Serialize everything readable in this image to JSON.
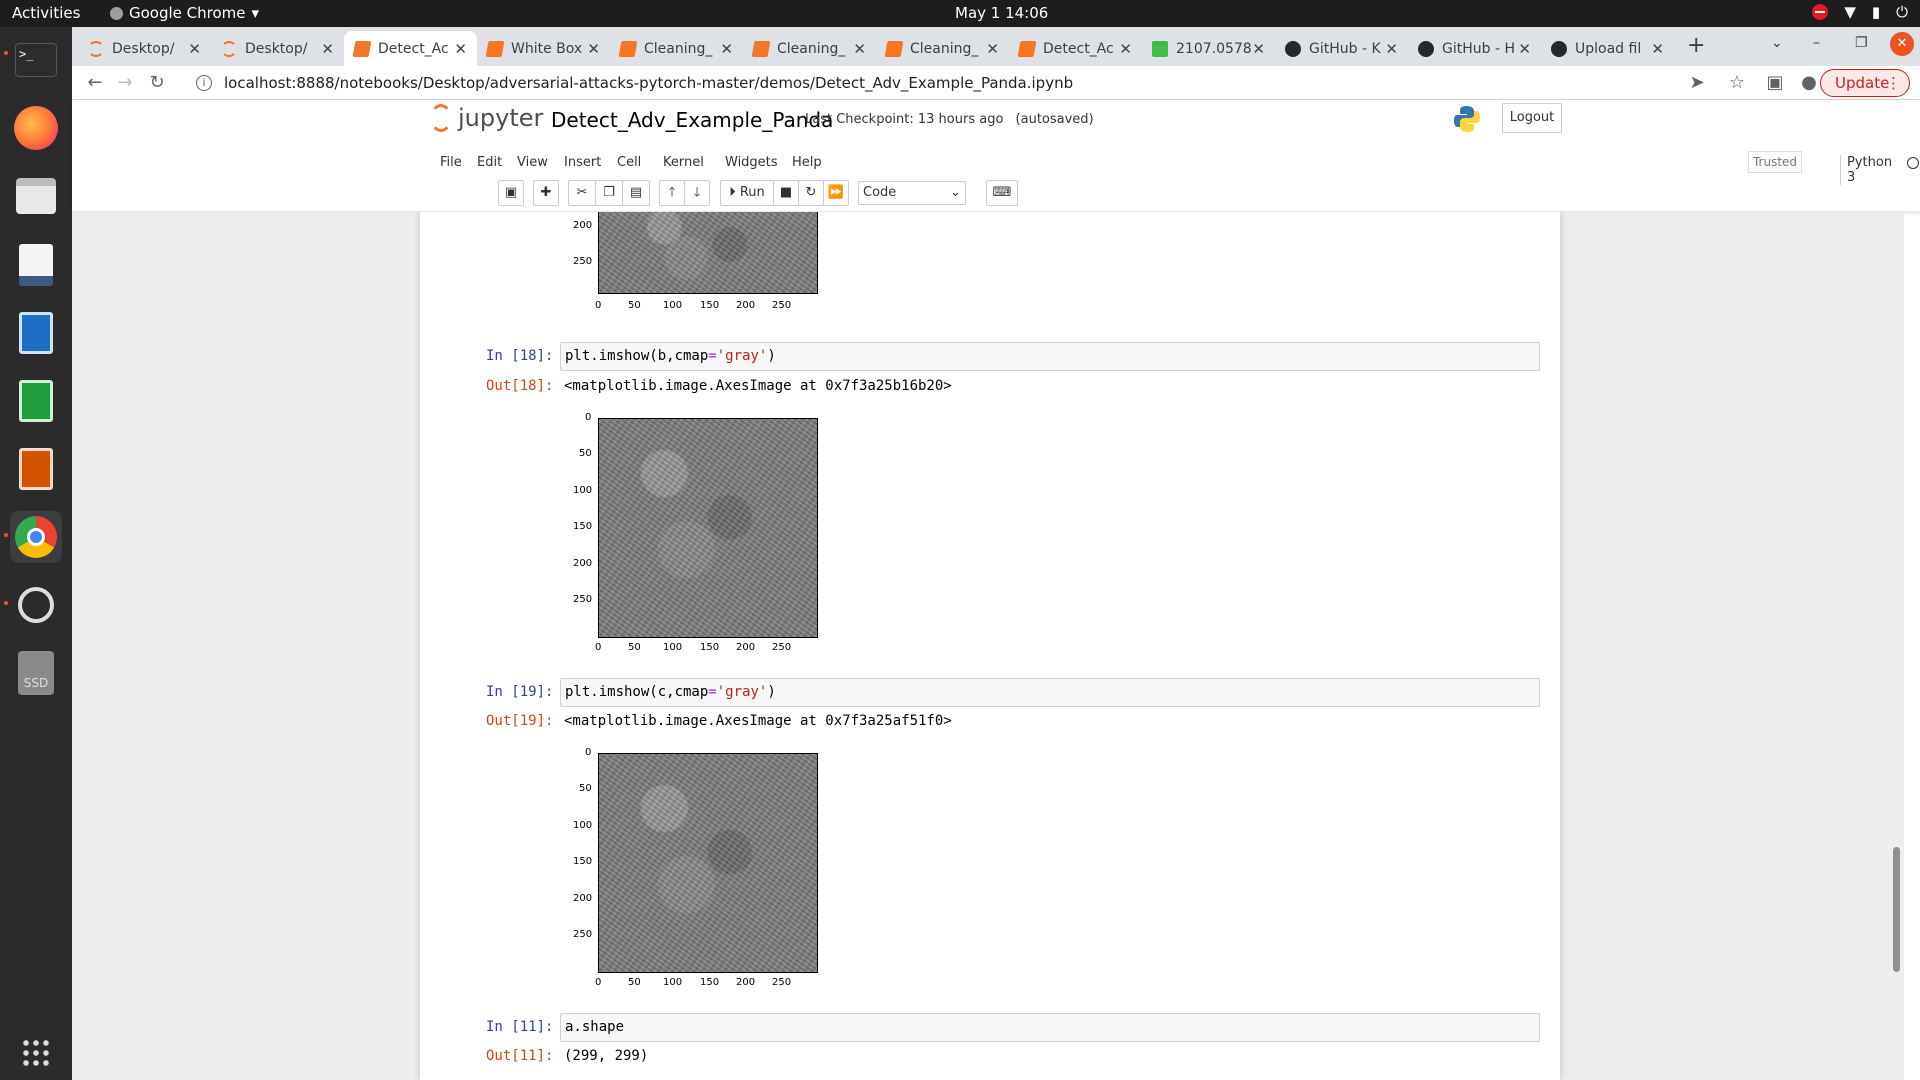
{
  "topbar": {
    "activities": "Activities",
    "app_name": "Google Chrome",
    "clock": "May 1  14:06"
  },
  "tabs": [
    {
      "label": "Desktop/",
      "icon": "jupyter-icon",
      "active": false
    },
    {
      "label": "Desktop/",
      "icon": "jupyter-icon",
      "active": false
    },
    {
      "label": "Detect_Ac",
      "icon": "jupyter-book-icon",
      "active": true
    },
    {
      "label": "White Box",
      "icon": "jupyter-book-icon",
      "active": false
    },
    {
      "label": "Cleaning_",
      "icon": "jupyter-book-icon",
      "active": false
    },
    {
      "label": "Cleaning_",
      "icon": "jupyter-book-icon",
      "active": false
    },
    {
      "label": "Cleaning_",
      "icon": "jupyter-book-icon",
      "active": false
    },
    {
      "label": "Detect_Ac",
      "icon": "jupyter-book-icon",
      "active": false
    },
    {
      "label": "2107.0578",
      "icon": "arxiv-icon",
      "active": false
    },
    {
      "label": "GitHub - K",
      "icon": "github-icon",
      "active": false
    },
    {
      "label": "GitHub - H",
      "icon": "github-icon",
      "active": false
    },
    {
      "label": "Upload fil",
      "icon": "github-icon",
      "active": false
    }
  ],
  "toolbar": {
    "url": "localhost:8888/notebooks/Desktop/adversarial-attacks-pytorch-master/demos/Detect_Adv_Example_Panda.ipynb",
    "update_label": "Update"
  },
  "jupyter": {
    "logo_text": "jupyter",
    "notebook_name": "Detect_Adv_Example_Panda",
    "checkpoint": "Last Checkpoint: 13 hours ago",
    "autosaved": "(autosaved)",
    "logout": "Logout",
    "menu": [
      "File",
      "Edit",
      "View",
      "Insert",
      "Cell",
      "Kernel",
      "Widgets",
      "Help"
    ],
    "trusted": "Trusted",
    "kernel": "Python 3",
    "run_label": "Run",
    "cell_type": "Code"
  },
  "cells": [
    {
      "prompt_in": "In [18]:",
      "code_a": "plt.imshow(b,cmap",
      "code_eq": "=",
      "code_str": "'gray'",
      "code_end": ")",
      "prompt_out": "Out[18]:",
      "output": "<matplotlib.image.AxesImage at 0x7f3a25b16b20>"
    },
    {
      "prompt_in": "In [19]:",
      "code_a": "plt.imshow(c,cmap",
      "code_eq": "=",
      "code_str": "'gray'",
      "code_end": ")",
      "prompt_out": "Out[19]:",
      "output": "<matplotlib.image.AxesImage at 0x7f3a25af51f0>"
    },
    {
      "prompt_in": "In [11]:",
      "code_a": "a.shape",
      "prompt_out": "Out[11]:",
      "output": "(299, 299)"
    }
  ],
  "plot_ticks": {
    "y": [
      "0",
      "50",
      "100",
      "150",
      "200",
      "250"
    ],
    "x": [
      "0",
      "50",
      "100",
      "150",
      "200",
      "250"
    ],
    "top_partial_y": [
      "200",
      "250"
    ]
  }
}
